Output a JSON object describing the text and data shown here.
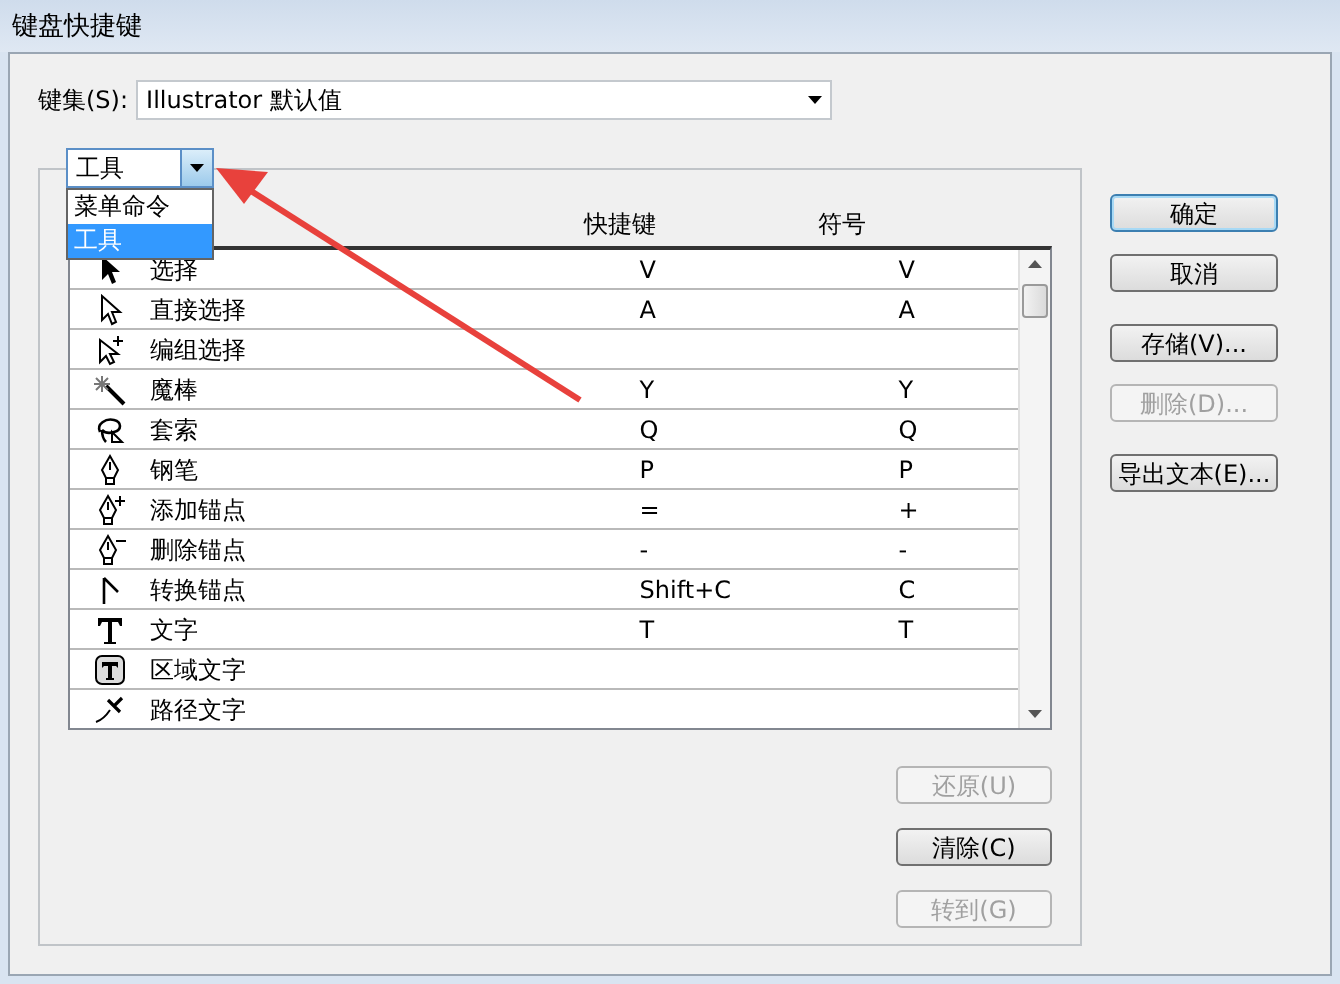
{
  "window": {
    "title": "键盘快捷键"
  },
  "keyset": {
    "label": "键集(S):",
    "value": "Illustrator 默认值"
  },
  "category": {
    "value": "工具",
    "expanded": true,
    "options": [
      {
        "label": "菜单命令",
        "selected": false
      },
      {
        "label": "工具",
        "selected": true
      }
    ]
  },
  "table": {
    "columns": [
      "快捷键",
      "符号"
    ],
    "rows": [
      {
        "name": "选择",
        "shortcut": "V",
        "symbol": "V"
      },
      {
        "name": "直接选择",
        "shortcut": "A",
        "symbol": "A"
      },
      {
        "name": "编组选择",
        "shortcut": "",
        "symbol": ""
      },
      {
        "name": "魔棒",
        "shortcut": "Y",
        "symbol": "Y"
      },
      {
        "name": "套索",
        "shortcut": "Q",
        "symbol": "Q"
      },
      {
        "name": "钢笔",
        "shortcut": "P",
        "symbol": "P"
      },
      {
        "name": "添加锚点",
        "shortcut": "=",
        "symbol": "+"
      },
      {
        "name": "删除锚点",
        "shortcut": "-",
        "symbol": "-"
      },
      {
        "name": "转换锚点",
        "shortcut": "Shift+C",
        "symbol": "C"
      },
      {
        "name": "文字",
        "shortcut": "T",
        "symbol": "T"
      },
      {
        "name": "区域文字",
        "shortcut": "",
        "symbol": ""
      },
      {
        "name": "路径文字",
        "shortcut": "",
        "symbol": ""
      }
    ]
  },
  "side_buttons": [
    {
      "label": "确定",
      "disabled": false,
      "default": true
    },
    {
      "label": "取消",
      "disabled": false,
      "default": false
    },
    {
      "label": "存储(V)...",
      "disabled": false,
      "default": false
    },
    {
      "label": "删除(D)...",
      "disabled": true,
      "default": false
    },
    {
      "label": "导出文本(E)...",
      "disabled": false,
      "default": false
    }
  ],
  "bottom_buttons": [
    {
      "label": "还原(U)",
      "disabled": true
    },
    {
      "label": "清除(C)",
      "disabled": false
    },
    {
      "label": "转到(G)",
      "disabled": true
    }
  ],
  "annotation": {
    "kind": "arrow"
  }
}
